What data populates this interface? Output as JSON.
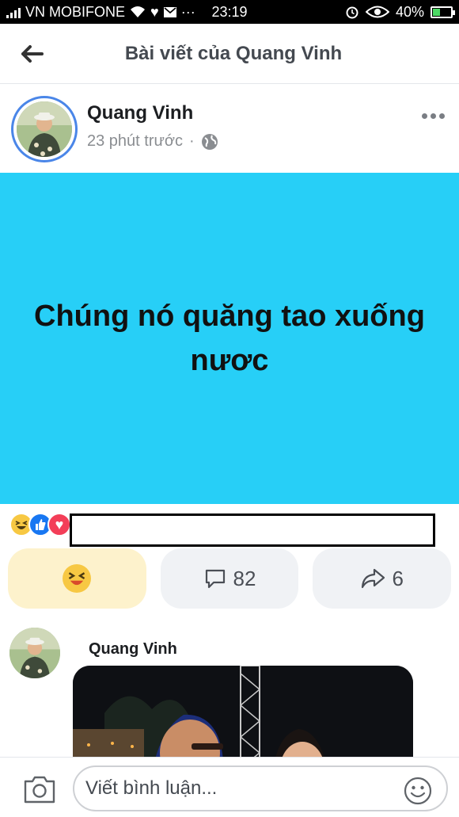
{
  "status": {
    "carrier": "VN MOBIFONE",
    "time": "23:19",
    "battery": "40%",
    "battery_level": 0.4
  },
  "header": {
    "title": "Bài viết của Quang Vinh"
  },
  "post": {
    "author": "Quang Vinh",
    "time": "23 phút trước",
    "separator": "·",
    "text": "Chúng nó quăng tao xuống nươc",
    "background": "#27cff7"
  },
  "reactions": {
    "types": [
      "haha-icon",
      "like-icon",
      "love-icon"
    ]
  },
  "actions": {
    "comment_count": "82",
    "share_count": "6"
  },
  "comment": {
    "author": "Quang Vinh"
  },
  "composer": {
    "placeholder": "Viết bình luận..."
  }
}
